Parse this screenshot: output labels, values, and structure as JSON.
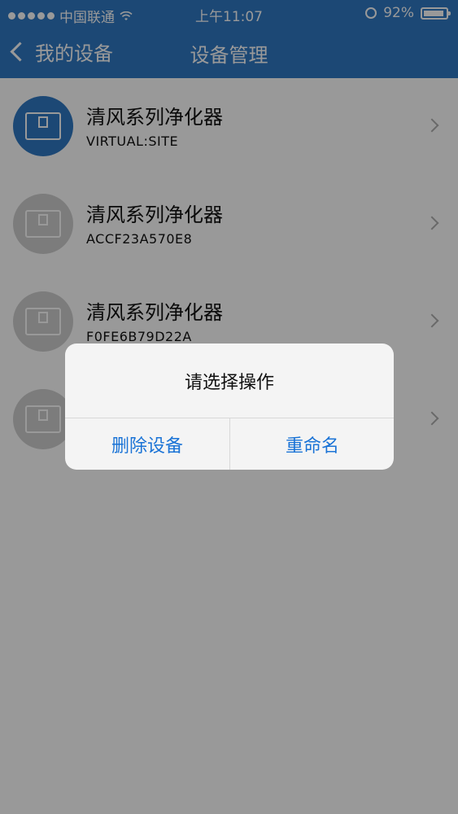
{
  "status_bar": {
    "carrier": "中国联通",
    "time": "上午11:07",
    "battery": "92%",
    "battery_level": 0.92
  },
  "nav": {
    "back_label": "我的设备",
    "title": "设备管理"
  },
  "devices": [
    {
      "name": "清风系列净化器",
      "id": "VIRTUAL:SITE",
      "active": true
    },
    {
      "name": "清风系列净化器",
      "id": "ACCF23A570E8",
      "active": false
    },
    {
      "name": "清风系列净化器",
      "id": "F0FE6B79D22A",
      "active": false
    },
    {
      "name": "",
      "id": "",
      "active": false
    }
  ],
  "dialog": {
    "title": "请选择操作",
    "delete_label": "删除设备",
    "rename_label": "重命名"
  },
  "colors": {
    "brand": "#2f78c4",
    "dialog_button": "#1a73d6"
  }
}
